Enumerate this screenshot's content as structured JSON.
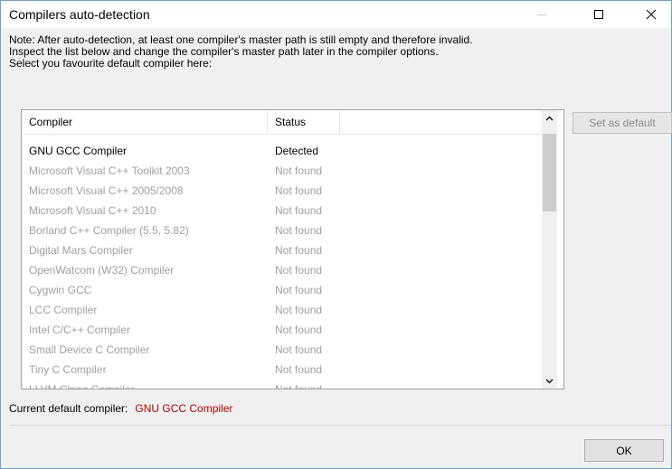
{
  "window": {
    "title": "Compilers auto-detection"
  },
  "note": {
    "line1": "Note: After auto-detection, at least one compiler's master path is still empty and therefore invalid.",
    "line2": "Inspect the list below and change the compiler's master path later in the compiler options.",
    "line3": "Select you favourite default compiler here:"
  },
  "list": {
    "columns": [
      "Compiler",
      "Status"
    ],
    "rows": [
      {
        "name": "GNU GCC Compiler",
        "status": "Detected",
        "enabled": true
      },
      {
        "name": "Microsoft Visual C++ Toolkit 2003",
        "status": "Not found",
        "enabled": false
      },
      {
        "name": "Microsoft Visual C++ 2005/2008",
        "status": "Not found",
        "enabled": false
      },
      {
        "name": "Microsoft Visual C++ 2010",
        "status": "Not found",
        "enabled": false
      },
      {
        "name": "Borland C++ Compiler (5.5, 5.82)",
        "status": "Not found",
        "enabled": false
      },
      {
        "name": "Digital Mars Compiler",
        "status": "Not found",
        "enabled": false
      },
      {
        "name": "OpenWatcom (W32) Compiler",
        "status": "Not found",
        "enabled": false
      },
      {
        "name": "Cygwin GCC",
        "status": "Not found",
        "enabled": false
      },
      {
        "name": "LCC Compiler",
        "status": "Not found",
        "enabled": false
      },
      {
        "name": "Intel C/C++ Compiler",
        "status": "Not found",
        "enabled": false
      },
      {
        "name": "Small Device C Compiler",
        "status": "Not found",
        "enabled": false
      },
      {
        "name": "Tiny C Compiler",
        "status": "Not found",
        "enabled": false
      },
      {
        "name": "LLVM Clang Compiler",
        "status": "Not found",
        "enabled": false
      }
    ]
  },
  "buttons": {
    "set_default": "Set as default",
    "ok": "OK"
  },
  "current_default": {
    "label": "Current default compiler:",
    "value": "GNU GCC Compiler"
  },
  "icons": {
    "minimize": "minimize-icon",
    "maximize": "maximize-icon",
    "close": "close-icon",
    "scroll_up": "chevron-up-icon",
    "scroll_down": "chevron-down-icon"
  }
}
